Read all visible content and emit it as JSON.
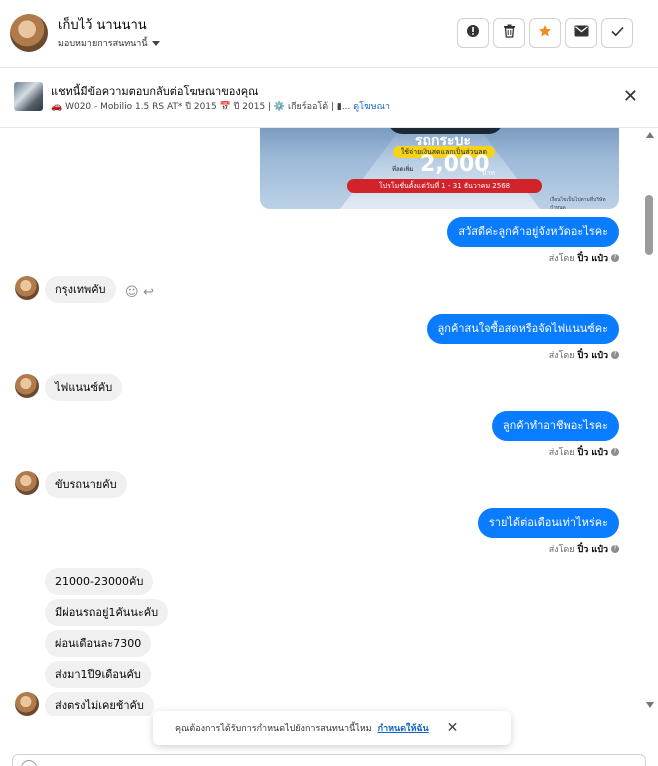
{
  "header": {
    "title": "เก็บไว้ นานนาน",
    "assign_label": "มอบหมายการสนทนานี้",
    "buttons": [
      {
        "name": "report-button",
        "icon": "exclamation-icon",
        "glyph": "❗"
      },
      {
        "name": "delete-button",
        "icon": "trash-icon",
        "glyph": "🗑"
      },
      {
        "name": "star-button",
        "icon": "star-icon",
        "glyph": "★"
      },
      {
        "name": "mail-button",
        "icon": "envelope-icon",
        "glyph": "✉"
      },
      {
        "name": "done-button",
        "icon": "check-icon",
        "glyph": "✓"
      }
    ],
    "star_color": "#f58a1f"
  },
  "ad": {
    "title": "แชทนี้มีข้อความตอบกลับต่อโฆษณาของคุณ",
    "subtitle": "🚗 W020 - Mobilio 1.5 RS AT* ปี 2015 📅 ปี 2015 | ⚙️ เกียร์ออโต้ | ▮...",
    "link": "ดูโฆษณา",
    "close_glyph": "✕"
  },
  "promo": {
    "headline": "รถกระบะ",
    "yellow": "ใช้จ่ายเงินสดแลกเป็นส่วนลด",
    "small": "ที่ลดเพิ่ม",
    "amount": "2,000",
    "unit": "บาท",
    "dates": "โปรโมชั่นตั้งแต่วันที่ 1 - 31 ธันวาคม 2568",
    "fineprint": "เงื่อนไขเป็นไปตามที่บริษัทกำหนด"
  },
  "messages": {
    "out1": "สวัสดีค่ะลูกค้าอยู่จังหวัดอะไรคะ",
    "in1": "กรุงเทพคับ",
    "out2": "ลูกค้าสนใจซื้อสดหรือจัดไฟแนนซ์คะ",
    "in2": "ไฟแนนซ์คับ",
    "out3": "ลูกค้าทำอาชีพอะไรคะ",
    "in3": "ขับรถนายคับ",
    "out4": "รายได้ต่อเดือนเท่าไหร่คะ",
    "in4a": "21000-23000คับ",
    "in4b": "มีผ่อนรถอยู่1คันนะคับ",
    "in4c": "ผ่อนเดือนละ7300",
    "in4d": "ส่งมา1ปี9เดือนคับ",
    "in4e": "ส่งตรงไม่เคยช้าคับ"
  },
  "sent_by": {
    "prefix": "ส่งโดย",
    "name": "ปิ๋ว แป๋ว"
  },
  "toast": {
    "text": "คุณต้องการได้รับการกำหนดไปยังการสนทนานี้ไหม",
    "link": "กำหนดให้ฉัน",
    "close_glyph": "✕"
  },
  "colors": {
    "accent": "#0a7cff",
    "incoming": "#f0f0f0"
  }
}
